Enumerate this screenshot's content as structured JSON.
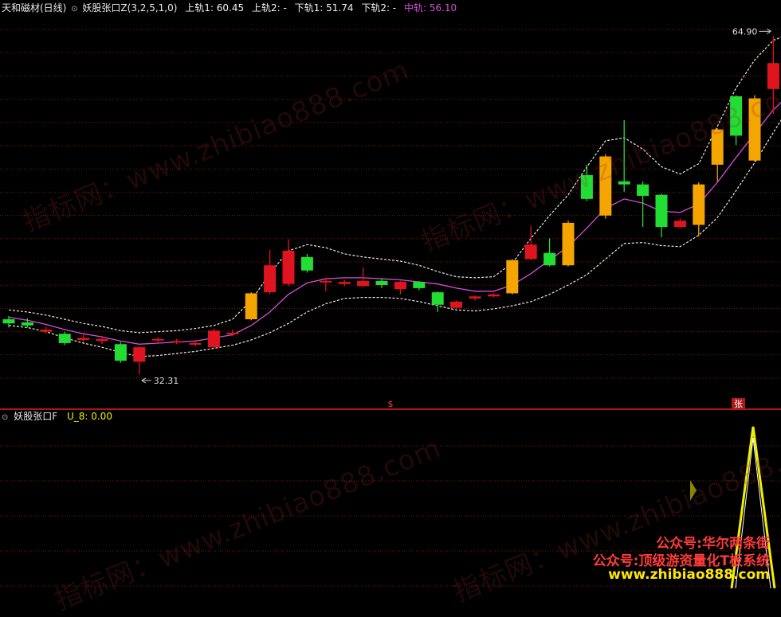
{
  "header": {
    "symbol": "天和磁材(日线)",
    "indicator": "妖股张口Z(3,2,5,1,0)",
    "upper1": "上轨1: 60.45",
    "upper2": "上轨2: -",
    "lower1": "下轨1: 51.74",
    "lower2": "下轨2: -",
    "mid": "中轨: 56.10"
  },
  "sub_header": {
    "indicator": "妖股张口F",
    "value": "U_8: 0.00"
  },
  "annotations": {
    "high_label": "64.90",
    "low_label": "32.31",
    "marker_mid": "$",
    "marker_right": "张"
  },
  "watermark": {
    "text": "指标网：www.zhibiao888.com"
  },
  "promo": {
    "line1": "公众号:华尔两条街",
    "line2": "公众号:顶级游资量化T板系统",
    "line3": "www.zhibiao888.com"
  },
  "colors": {
    "up_green": "#22dd33",
    "down_red": "#e0141e",
    "bull_orange": "#f5a500",
    "mid_line": "#d24fd6",
    "band": "#e8e8e8",
    "grid": "#7a1414",
    "sub_line": "#f0f000"
  },
  "chart_data": {
    "type": "candlestick",
    "price_range": [
      30,
      67
    ],
    "candles": [
      {
        "o": 37.2,
        "c": 37.6,
        "h": 37.9,
        "l": 36.8,
        "k": "g"
      },
      {
        "o": 37.0,
        "c": 37.3,
        "h": 37.7,
        "l": 36.8,
        "k": "g"
      },
      {
        "o": 36.6,
        "c": 36.4,
        "h": 36.9,
        "l": 36.2,
        "k": "r"
      },
      {
        "o": 36.2,
        "c": 35.3,
        "h": 36.4,
        "l": 35.1,
        "k": "g"
      },
      {
        "o": 35.6,
        "c": 35.8,
        "h": 36.1,
        "l": 35.4,
        "k": "r"
      },
      {
        "o": 35.5,
        "c": 35.7,
        "h": 35.9,
        "l": 35.2,
        "k": "r"
      },
      {
        "o": 35.2,
        "c": 33.6,
        "h": 35.4,
        "l": 33.4,
        "k": "g"
      },
      {
        "o": 33.5,
        "c": 34.9,
        "h": 35.0,
        "l": 32.3,
        "k": "r"
      },
      {
        "o": 35.6,
        "c": 35.7,
        "h": 35.9,
        "l": 35.4,
        "k": "r"
      },
      {
        "o": 35.4,
        "c": 35.5,
        "h": 35.7,
        "l": 35.2,
        "k": "r"
      },
      {
        "o": 35.2,
        "c": 35.3,
        "h": 35.6,
        "l": 35.0,
        "k": "r"
      },
      {
        "o": 34.9,
        "c": 36.5,
        "h": 36.7,
        "l": 34.8,
        "k": "r"
      },
      {
        "o": 36.2,
        "c": 36.3,
        "h": 36.6,
        "l": 36.0,
        "k": "r"
      },
      {
        "o": 37.6,
        "c": 40.1,
        "h": 40.2,
        "l": 37.5,
        "k": "o"
      },
      {
        "o": 40.2,
        "c": 42.8,
        "h": 44.3,
        "l": 40.0,
        "k": "r"
      },
      {
        "o": 41.0,
        "c": 44.2,
        "h": 45.3,
        "l": 40.8,
        "k": "r"
      },
      {
        "o": 43.6,
        "c": 42.3,
        "h": 43.9,
        "l": 42.1,
        "k": "g"
      },
      {
        "o": 41.2,
        "c": 41.3,
        "h": 41.6,
        "l": 40.3,
        "k": "r"
      },
      {
        "o": 41.0,
        "c": 41.2,
        "h": 41.4,
        "l": 40.8,
        "k": "r"
      },
      {
        "o": 40.8,
        "c": 41.3,
        "h": 42.6,
        "l": 40.7,
        "k": "r"
      },
      {
        "o": 41.3,
        "c": 40.9,
        "h": 41.5,
        "l": 40.6,
        "k": "g"
      },
      {
        "o": 40.5,
        "c": 41.2,
        "h": 41.3,
        "l": 40.0,
        "k": "r"
      },
      {
        "o": 41.2,
        "c": 40.6,
        "h": 41.3,
        "l": 40.4,
        "k": "g"
      },
      {
        "o": 40.2,
        "c": 39.0,
        "h": 40.3,
        "l": 38.3,
        "k": "g"
      },
      {
        "o": 38.7,
        "c": 39.3,
        "h": 39.4,
        "l": 38.6,
        "k": "r"
      },
      {
        "o": 39.6,
        "c": 39.8,
        "h": 39.9,
        "l": 39.4,
        "k": "r"
      },
      {
        "o": 39.8,
        "c": 40.0,
        "h": 40.1,
        "l": 39.7,
        "k": "r"
      },
      {
        "o": 40.1,
        "c": 43.3,
        "h": 43.4,
        "l": 40.0,
        "k": "o"
      },
      {
        "o": 43.4,
        "c": 44.8,
        "h": 46.6,
        "l": 43.3,
        "k": "r"
      },
      {
        "o": 44.0,
        "c": 42.8,
        "h": 45.4,
        "l": 42.7,
        "k": "g"
      },
      {
        "o": 42.8,
        "c": 46.9,
        "h": 47.1,
        "l": 42.7,
        "k": "o"
      },
      {
        "o": 51.5,
        "c": 49.2,
        "h": 52.5,
        "l": 49.0,
        "k": "g"
      },
      {
        "o": 47.6,
        "c": 53.3,
        "h": 53.5,
        "l": 47.3,
        "k": "o"
      },
      {
        "o": 50.9,
        "c": 50.6,
        "h": 56.8,
        "l": 49.9,
        "k": "g"
      },
      {
        "o": 50.6,
        "c": 49.5,
        "h": 50.9,
        "l": 46.5,
        "k": "g"
      },
      {
        "o": 49.6,
        "c": 46.5,
        "h": 49.7,
        "l": 45.5,
        "k": "g"
      },
      {
        "o": 46.5,
        "c": 47.1,
        "h": 47.3,
        "l": 46.4,
        "k": "r"
      },
      {
        "o": 46.7,
        "c": 50.6,
        "h": 50.8,
        "l": 45.6,
        "k": "o"
      },
      {
        "o": 52.5,
        "c": 55.9,
        "h": 56.0,
        "l": 50.9,
        "k": "o"
      },
      {
        "o": 59.1,
        "c": 55.3,
        "h": 59.2,
        "l": 54.4,
        "k": "g"
      },
      {
        "o": 52.9,
        "c": 58.9,
        "h": 59.2,
        "l": 52.8,
        "k": "o"
      },
      {
        "o": 59.8,
        "c": 62.3,
        "h": 64.9,
        "l": 57.4,
        "k": "r"
      },
      {
        "o": 60.5,
        "c": 59.7,
        "h": 63.0,
        "l": 58.9,
        "k": "r"
      }
    ],
    "mid_line": [
      37.8,
      37.5,
      37.1,
      36.6,
      36.2,
      35.9,
      35.5,
      35.2,
      35.3,
      35.4,
      35.5,
      35.8,
      36.1,
      37.0,
      38.3,
      40.0,
      41.1,
      41.5,
      41.6,
      41.6,
      41.5,
      41.4,
      41.2,
      41.0,
      40.6,
      40.3,
      40.3,
      40.9,
      42.0,
      43.3,
      44.6,
      46.4,
      48.3,
      49.2,
      48.8,
      48.0,
      47.9,
      48.7,
      50.8,
      53.2,
      55.5,
      57.8,
      59.5
    ],
    "upper_band": [
      38.5,
      38.3,
      38.0,
      37.6,
      37.2,
      36.9,
      36.5,
      36.3,
      36.4,
      36.5,
      36.7,
      37.0,
      37.6,
      39.4,
      42.0,
      44.2,
      44.8,
      44.5,
      43.9,
      43.6,
      43.4,
      43.2,
      42.8,
      42.2,
      41.7,
      41.6,
      41.7,
      43.0,
      45.4,
      47.6,
      49.6,
      52.3,
      54.8,
      55.1,
      54.0,
      52.3,
      51.6,
      52.6,
      56.2,
      59.9,
      62.6,
      64.5,
      65.2
    ],
    "lower_band": [
      37.0,
      36.8,
      36.4,
      35.8,
      35.3,
      34.9,
      34.4,
      34.0,
      34.1,
      34.3,
      34.5,
      34.8,
      35.1,
      35.6,
      36.3,
      37.2,
      38.3,
      39.1,
      39.6,
      39.7,
      39.7,
      39.6,
      39.3,
      38.9,
      38.5,
      38.4,
      38.6,
      38.9,
      39.3,
      40.0,
      40.9,
      41.9,
      43.4,
      44.9,
      45.0,
      44.7,
      44.6,
      45.7,
      47.4,
      50.0,
      52.7,
      55.6,
      58.5
    ],
    "high_marker": 64.9,
    "low_marker": 32.31,
    "sub_spike_index": 40,
    "sub_spike_value": 1
  }
}
